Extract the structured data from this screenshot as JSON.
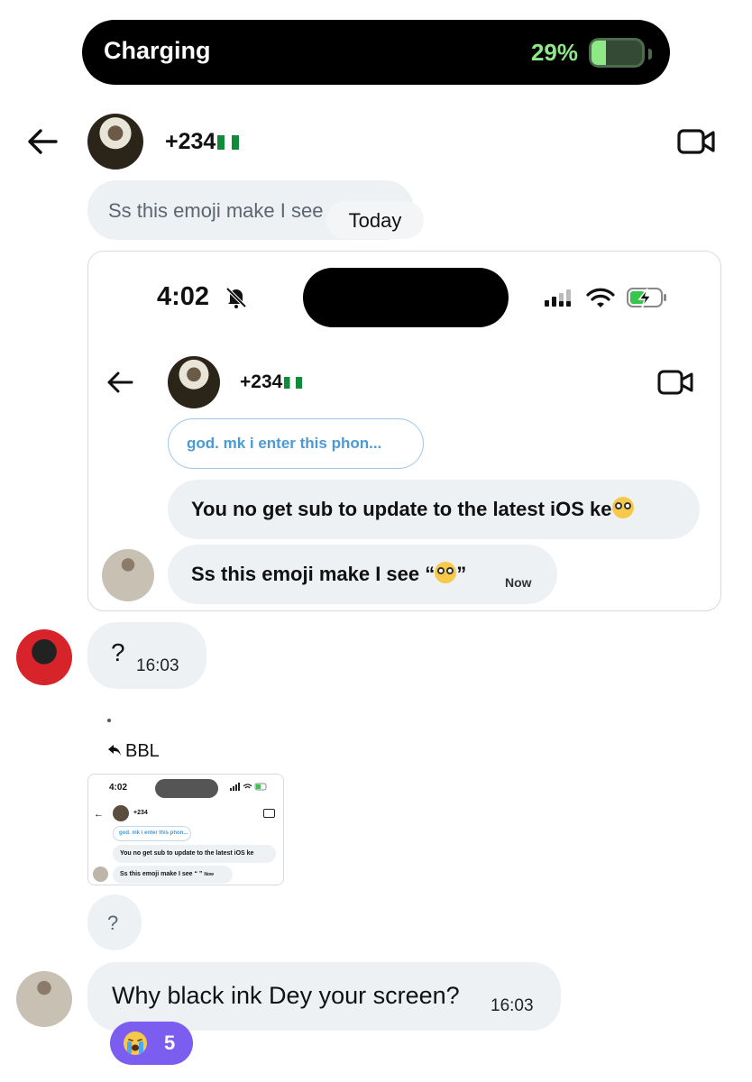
{
  "status_pill": {
    "label": "Charging",
    "percent_text": "29%",
    "battery_level": 0.29,
    "accent": "#8ee886"
  },
  "header": {
    "contact": "+234"
  },
  "preview": {
    "text": "Ss this emoji make I see",
    "date_chip": "Today"
  },
  "embedded_screenshot": {
    "time": "4:02",
    "contact": "+234",
    "reply_preview": "god. mk i enter this phon...",
    "message1": "You no get sub to update to the latest iOS ke",
    "message2_pre": "Ss this emoji make I see “",
    "message2_post": "”",
    "message2_time": "Now"
  },
  "messages": [
    {
      "text": "?",
      "time": "16:03"
    }
  ],
  "forward": {
    "dot": "•",
    "label": "BBL"
  },
  "thumbnail": {
    "time": "4:02",
    "contact": "+234",
    "reply_preview": "god. mk i enter this phon...",
    "message1": "You no get sub to update to the latest iOS ke",
    "message2": "Ss this emoji make I see “ ”",
    "message2_time": "Now"
  },
  "reply_question": {
    "text": "?"
  },
  "last_message": {
    "text": "Why black ink Dey your screen?",
    "time": "16:03",
    "reaction_count": "5",
    "reaction_color": "#7b5df0"
  },
  "icons": [
    "back-arrow-icon",
    "video-call-icon",
    "bell-muted-icon",
    "signal-icon",
    "wifi-icon",
    "battery-charging-icon",
    "reply-arrow-icon",
    "crying-emoji-icon",
    "flushed-emoji-icon"
  ]
}
